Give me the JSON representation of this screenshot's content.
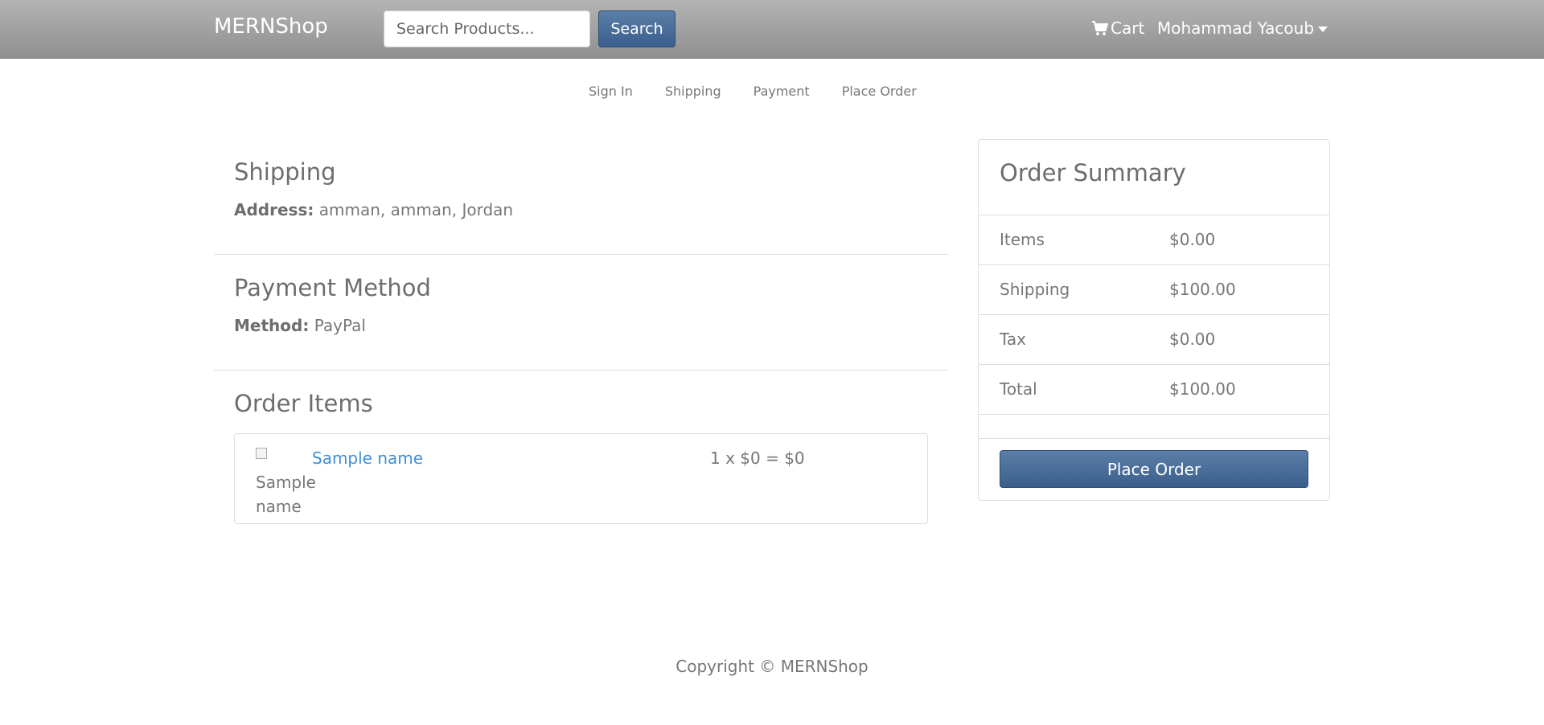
{
  "navbar": {
    "brand": "MERNShop",
    "search_placeholder": "Search Products...",
    "search_button": "Search",
    "cart_label": "Cart",
    "user_name": "Mohammad Yacoub"
  },
  "steps": [
    {
      "label": "Sign In"
    },
    {
      "label": "Shipping"
    },
    {
      "label": "Payment"
    },
    {
      "label": "Place Order"
    }
  ],
  "shipping": {
    "heading": "Shipping",
    "address_label": "Address:",
    "address_value": "amman, amman, Jordan"
  },
  "payment": {
    "heading": "Payment Method",
    "method_label": "Method:",
    "method_value": "PayPal"
  },
  "order_items": {
    "heading": "Order Items",
    "items": [
      {
        "image_alt": "Sample name",
        "name": "Sample name",
        "calc": "1 x $0 = $0"
      }
    ]
  },
  "summary": {
    "heading": "Order Summary",
    "rows": [
      {
        "label": "Items",
        "value": "$0.00"
      },
      {
        "label": "Shipping",
        "value": "$100.00"
      },
      {
        "label": "Tax",
        "value": "$0.00"
      },
      {
        "label": "Total",
        "value": "$100.00"
      }
    ],
    "button": "Place Order"
  },
  "footer": {
    "text": "Copyright © MERNShop"
  },
  "colors": {
    "link": "#3f8fd9",
    "primary_button": "#3b5f8c",
    "navbar": "#a3a3a3"
  }
}
